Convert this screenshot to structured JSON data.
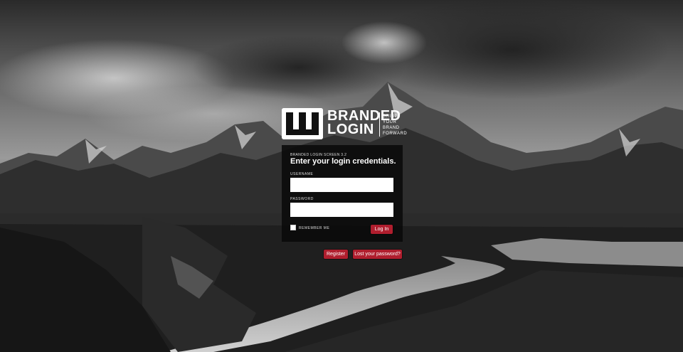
{
  "logo": {
    "wordmark_line1": "BRANDED",
    "wordmark_line2": "LOGIN",
    "tagline_line1": "BRING",
    "tagline_line2": "YOUR",
    "tagline_line3": "BRAND",
    "tagline_line4": "FORWARD"
  },
  "form": {
    "version": "BRANDED LOGIN SCREEN 3.2",
    "heading": "Enter your login credentials.",
    "username_label": "USERNAME",
    "username_value": "",
    "password_label": "PASSWORD",
    "password_value": "",
    "remember_label": "REMEMBER ME",
    "login_button": "Log In"
  },
  "links": {
    "register": "Register",
    "lost_password": "Lost your password?"
  },
  "colors": {
    "accent": "#b01e2e",
    "panel": "#0a0a0a"
  }
}
